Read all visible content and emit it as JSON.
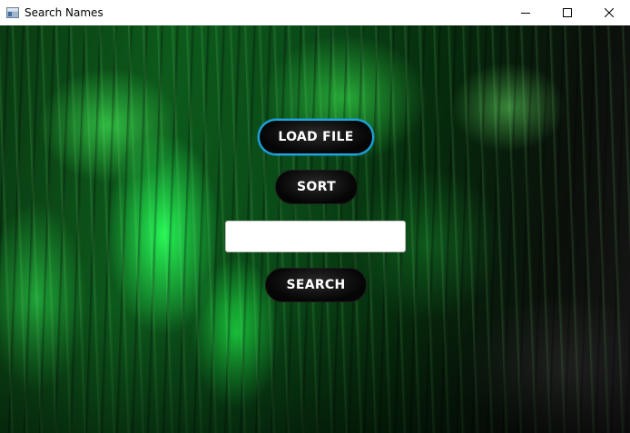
{
  "window": {
    "title": "Search Names",
    "controls": {
      "minimize_icon": "minimize-icon",
      "maximize_icon": "maximize-icon",
      "close_icon": "close-icon"
    }
  },
  "main": {
    "background": "green-lit-tree-moss-photo",
    "load_file_label": "LOAD FILE",
    "sort_label": "SORT",
    "search_input": {
      "value": "",
      "placeholder": ""
    },
    "search_label": "SEARCH"
  },
  "colors": {
    "focus_ring": "#1fa6e0",
    "button_bg": "#0a0a0a",
    "button_text": "#ffffff",
    "background_green": "#1fd048"
  }
}
